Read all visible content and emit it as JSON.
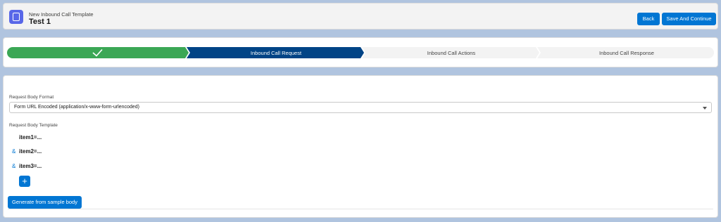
{
  "header": {
    "subtitle": "New Inbound Call Template",
    "title": "Test 1",
    "back_label": "Back",
    "save_label": "Save And Continue"
  },
  "path": {
    "steps": [
      {
        "label": "",
        "state": "complete"
      },
      {
        "label": "Inbound Call Request",
        "state": "current"
      },
      {
        "label": "Inbound Call Actions",
        "state": "incomplete"
      },
      {
        "label": "Inbound Call Response",
        "state": "incomplete"
      }
    ]
  },
  "form": {
    "format_label": "Request Body Format",
    "format_value": "Form URL Encoded (application/x-www-form-urlencoded)",
    "template_label": "Request Body Template",
    "items": [
      {
        "prefix": "",
        "text": "item1=..."
      },
      {
        "prefix": "&",
        "text": "item2=..."
      },
      {
        "prefix": "&",
        "text": "item3=..."
      }
    ],
    "add_label": "+",
    "generate_label": "Generate from sample body"
  },
  "colors": {
    "complete": "#3ba755",
    "current": "#014486",
    "incomplete": "#f3f3f3",
    "brand": "#0176d3"
  }
}
